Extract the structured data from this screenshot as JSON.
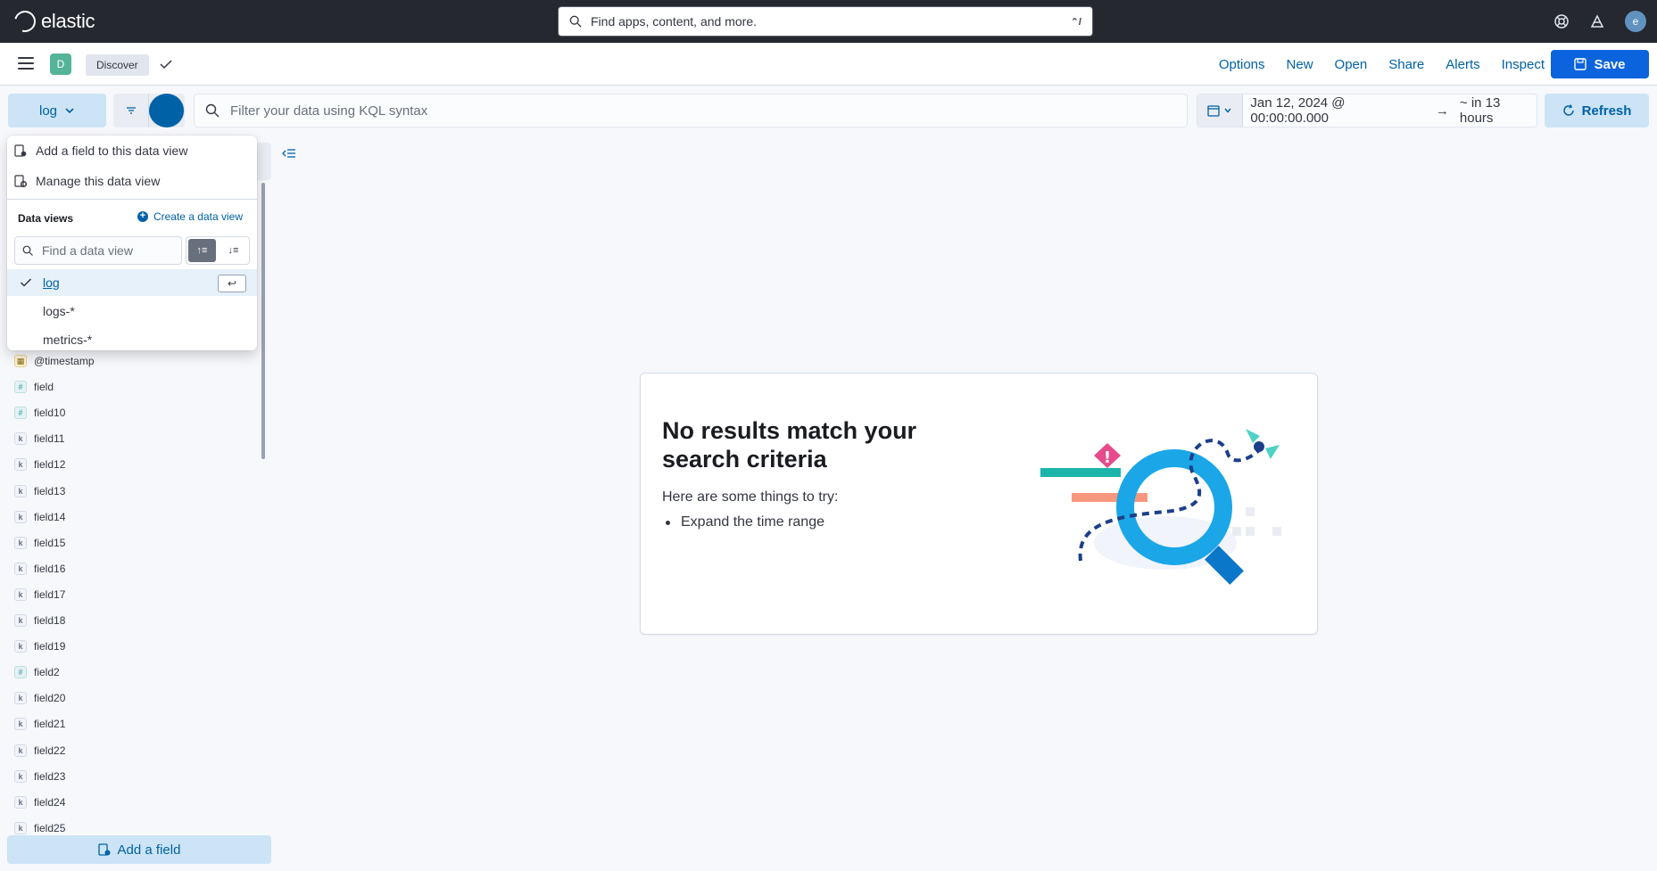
{
  "topbar": {
    "brand": "elastic",
    "search_placeholder": "Find apps, content, and more.",
    "search_shortcut": "⌃/",
    "avatar_initial": "e"
  },
  "app_header": {
    "space_initial": "D",
    "breadcrumb": "Discover",
    "links": [
      "Options",
      "New",
      "Open",
      "Share",
      "Alerts",
      "Inspect"
    ],
    "save_label": "Save"
  },
  "query_bar": {
    "data_view": "log",
    "kql_placeholder": "Filter your data using KQL syntax",
    "date_start": "Jan 12, 2024 @ 00:00:00.000",
    "date_end": "~ in 13 hours",
    "refresh_label": "Refresh"
  },
  "popover": {
    "add_field": "Add a field to this data view",
    "manage": "Manage this data view",
    "section_title": "Data views",
    "create_label": "Create a data view",
    "search_placeholder": "Find a data view",
    "items": [
      "log",
      "logs-*",
      "metrics-*"
    ],
    "selected": "log"
  },
  "sidebar": {
    "fields": [
      {
        "type": "date",
        "symbol": "▦",
        "name": "@timestamp"
      },
      {
        "type": "num",
        "symbol": "#",
        "name": "field"
      },
      {
        "type": "num",
        "symbol": "#",
        "name": "field10"
      },
      {
        "type": "kw",
        "symbol": "k",
        "name": "field11"
      },
      {
        "type": "kw",
        "symbol": "k",
        "name": "field12"
      },
      {
        "type": "kw",
        "symbol": "k",
        "name": "field13"
      },
      {
        "type": "kw",
        "symbol": "k",
        "name": "field14"
      },
      {
        "type": "kw",
        "symbol": "k",
        "name": "field15"
      },
      {
        "type": "kw",
        "symbol": "k",
        "name": "field16"
      },
      {
        "type": "kw",
        "symbol": "k",
        "name": "field17"
      },
      {
        "type": "kw",
        "symbol": "k",
        "name": "field18"
      },
      {
        "type": "kw",
        "symbol": "k",
        "name": "field19"
      },
      {
        "type": "num",
        "symbol": "#",
        "name": "field2"
      },
      {
        "type": "kw",
        "symbol": "k",
        "name": "field20"
      },
      {
        "type": "kw",
        "symbol": "k",
        "name": "field21"
      },
      {
        "type": "kw",
        "symbol": "k",
        "name": "field22"
      },
      {
        "type": "kw",
        "symbol": "k",
        "name": "field23"
      },
      {
        "type": "kw",
        "symbol": "k",
        "name": "field24"
      },
      {
        "type": "kw",
        "symbol": "k",
        "name": "field25"
      }
    ],
    "add_field_label": "Add a field"
  },
  "empty_state": {
    "title": "No results match your search criteria",
    "subtitle": "Here are some things to try:",
    "suggestion": "Expand the time range"
  },
  "colors": {
    "primary": "#0061a6",
    "save_bg": "#0b64dd",
    "header_dark": "#25282f"
  }
}
